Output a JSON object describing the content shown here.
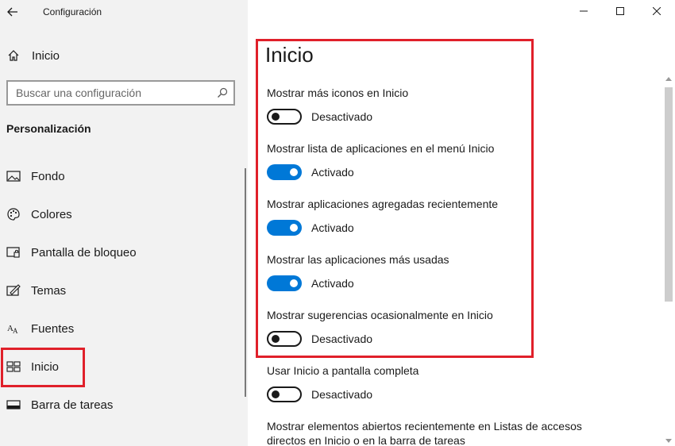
{
  "app": {
    "title": "Configuración"
  },
  "sidebar": {
    "home_label": "Inicio",
    "search_placeholder": "Buscar una configuración",
    "section_title": "Personalización",
    "items": [
      {
        "label": "Fondo",
        "icon": "image-icon"
      },
      {
        "label": "Colores",
        "icon": "palette-icon"
      },
      {
        "label": "Pantalla de bloqueo",
        "icon": "lock-screen-icon"
      },
      {
        "label": "Temas",
        "icon": "themes-icon"
      },
      {
        "label": "Fuentes",
        "icon": "fonts-icon"
      },
      {
        "label": "Inicio",
        "icon": "start-icon",
        "selected": true
      },
      {
        "label": "Barra de tareas",
        "icon": "taskbar-icon"
      }
    ]
  },
  "main": {
    "title": "Inicio",
    "settings": [
      {
        "label": "Mostrar más iconos en Inicio",
        "state": "Desactivado",
        "on": false
      },
      {
        "label": "Mostrar lista de aplicaciones en el menú Inicio",
        "state": "Activado",
        "on": true
      },
      {
        "label": "Mostrar aplicaciones agregadas recientemente",
        "state": "Activado",
        "on": true
      },
      {
        "label": "Mostrar las aplicaciones más usadas",
        "state": "Activado",
        "on": true
      },
      {
        "label": "Mostrar sugerencias ocasionalmente en Inicio",
        "state": "Desactivado",
        "on": false
      },
      {
        "label": "Usar Inicio a pantalla completa",
        "state": "Desactivado",
        "on": false
      }
    ],
    "last_setting_label": "Mostrar elementos abiertos recientemente en Listas de accesos directos en Inicio o en la barra de tareas"
  },
  "colors": {
    "accent": "#0078d7",
    "highlight_border": "#e0202a",
    "sidebar_bg": "#f2f2f2"
  }
}
